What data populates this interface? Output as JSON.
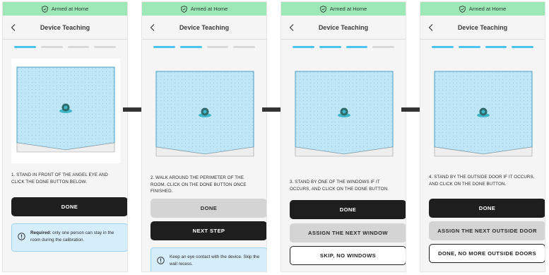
{
  "status_bar_text": "Armed at Home",
  "header_title": "Device Teaching",
  "colors": {
    "status_bar": "#9ee8b8",
    "progress_active": "#4cc3f0",
    "room_fill": "#bfe6f6",
    "button_dark": "#1e1e1e",
    "info_bg": "#d6eefa"
  },
  "screens": [
    {
      "steps_completed": 1,
      "instruction": "1. STAND IN FRONT OF THE ANGEL EYE AND CLICK THE DONE BUTTON BELOW.",
      "buttons": [
        "DONE"
      ],
      "info_label": "Required:",
      "info_text": "only one person can stay in the room during the calibration."
    },
    {
      "steps_completed": 2,
      "instruction": "2. WALK AROUND THE PERIMETER OF THE ROOM. CLICK ON THE DONE BUTTON ONCE FINISHED.",
      "buttons": [
        "DONE",
        "NEXT STEP"
      ],
      "info_text": "Keep an eye contact with the device. Skip the wall recess."
    },
    {
      "steps_completed": 3,
      "instruction": "3. STAND BY ONE OF THE WINDOWS IF IT OCCURS, AND CLICK ON THE DONE BUTTON.",
      "buttons": [
        "DONE",
        "ASSIGN THE NEXT WINDOW",
        "SKIP, NO WINDOWS"
      ]
    },
    {
      "steps_completed": 4,
      "instruction": "4. STAND BY THE OUTSIDE DOOR IF IT OCCURS, AND CLICK ON THE DONE BUTTON.",
      "buttons": [
        "DONE",
        "ASSIGN THE NEXT OUTSIDE DOOR",
        "DONE, NO MORE OUTSIDE DOORS"
      ]
    }
  ]
}
